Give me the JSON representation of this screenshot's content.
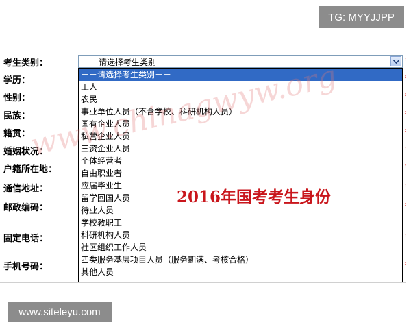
{
  "badges": {
    "telegram": "TG: MYYJJPP",
    "site": "www.siteleyu.com"
  },
  "form": {
    "labels": [
      "考生类别：",
      "学历：",
      "性别：",
      "民族：",
      "籍贯：",
      "婚姻状况：",
      "户籍所在地：",
      "通信地址：",
      "邮政编码：",
      "固定电话：",
      "手机号码："
    ],
    "required_mark": "*",
    "select": {
      "value": "－－请选择考生类别－－",
      "options": [
        "－－请选择考生类别－－",
        "工人",
        "农民",
        "事业单位人员（不含学校、科研机构人员）",
        "国有企业人员",
        "私营企业人员",
        "三资企业人员",
        "个体经营者",
        "自由职业者",
        "应届毕业生",
        "留学回国人员",
        "待业人员",
        "学校教职工",
        "科研机构人员",
        "社区组织工作人员",
        "四类服务基层项目人员（服务期满、考核合格）",
        "其他人员"
      ],
      "selected_index": 0
    }
  },
  "watermark": "www.chinagwyw.org",
  "caption": "2016年国考考生身份",
  "colors": {
    "highlight": "#316ac5",
    "caption": "#c9161c",
    "required": "#e00000",
    "badge_bg": "#8c8c8c"
  }
}
